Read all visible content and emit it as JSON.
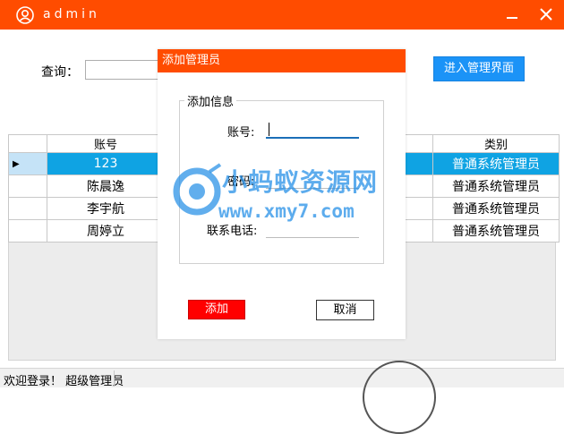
{
  "window": {
    "title": "admin",
    "icons": {
      "user": "user-circle-icon",
      "minimize": "minimize-icon",
      "close": "close-icon"
    },
    "accent_color": "#ff4c00"
  },
  "query": {
    "label": "查询：",
    "value": ""
  },
  "toolbar": {
    "manage_label": "进入管理界面",
    "manage_color": "#1b93f7"
  },
  "grid": {
    "headers": [
      "账号",
      "类别"
    ],
    "rows": [
      {
        "account": "123",
        "category": "普通系统管理员",
        "selected": true
      },
      {
        "account": "陈晨逸",
        "category": "普通系统管理员",
        "selected": false
      },
      {
        "account": "李宇航",
        "category": "普通系统管理员",
        "selected": false
      },
      {
        "account": "周婷立",
        "category": "普通系统管理员",
        "selected": false
      }
    ],
    "selected_color": "#0fa3e3",
    "row_indicator": "▶"
  },
  "status": {
    "text": "欢迎登录！ 超级管理员"
  },
  "dialog": {
    "title": "添加管理员",
    "group_title": "添加信息",
    "fields": {
      "account": {
        "label": "账号:",
        "value": ""
      },
      "password": {
        "label": "密码:",
        "value": ""
      },
      "phone": {
        "label": "联系电话:",
        "value": ""
      }
    },
    "add_label": "添加",
    "add_color": "#ff0000",
    "cancel_label": "取消"
  },
  "watermark": {
    "main": "小蚂蚁资源网",
    "sub": "www.xmy7.com"
  }
}
